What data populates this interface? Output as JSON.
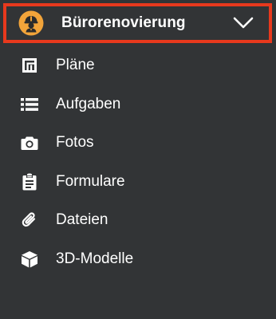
{
  "project": {
    "title": "Bürorenovierung",
    "avatar_icon": "hard-hat-worker-icon",
    "dropdown_icon": "chevron-down-icon",
    "highlight_color": "#e8391d",
    "avatar_color": "#f2a43a"
  },
  "nav": {
    "items": [
      {
        "label": "Pläne",
        "icon": "plans-icon"
      },
      {
        "label": "Aufgaben",
        "icon": "list-icon"
      },
      {
        "label": "Fotos",
        "icon": "camera-icon"
      },
      {
        "label": "Formulare",
        "icon": "clipboard-icon"
      },
      {
        "label": "Dateien",
        "icon": "paperclip-icon"
      },
      {
        "label": "3D-Modelle",
        "icon": "cube-icon"
      }
    ]
  },
  "colors": {
    "background": "#323436",
    "text": "#ffffff"
  }
}
